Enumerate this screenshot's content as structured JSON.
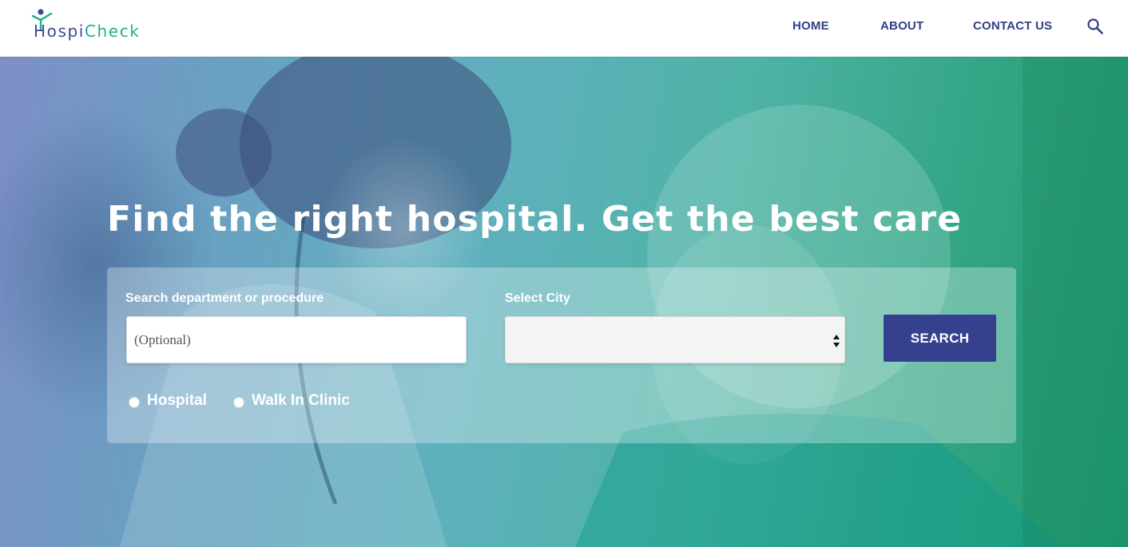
{
  "brand": {
    "name_part1": "Hospi",
    "name_part2": "Check",
    "logo_icon": "person-plus-icon"
  },
  "nav": {
    "items": [
      {
        "label": "HOME"
      },
      {
        "label": "ABOUT"
      },
      {
        "label": "CONTACT US"
      }
    ],
    "search_icon": "search-icon"
  },
  "hero": {
    "title": "Find the right hospital. Get the best care"
  },
  "search_form": {
    "department_label": "Search department or procedure",
    "department_placeholder": "(Optional)",
    "department_value": "",
    "city_label": "Select City",
    "city_selected": "",
    "search_button": "SEARCH",
    "facility_types": [
      {
        "label": "Hospital",
        "checked": false
      },
      {
        "label": "Walk In Clinic",
        "checked": false
      }
    ]
  },
  "colors": {
    "brand_navy": "#2f3f86",
    "brand_green": "#1fb08a",
    "button_navy": "#35418f"
  }
}
